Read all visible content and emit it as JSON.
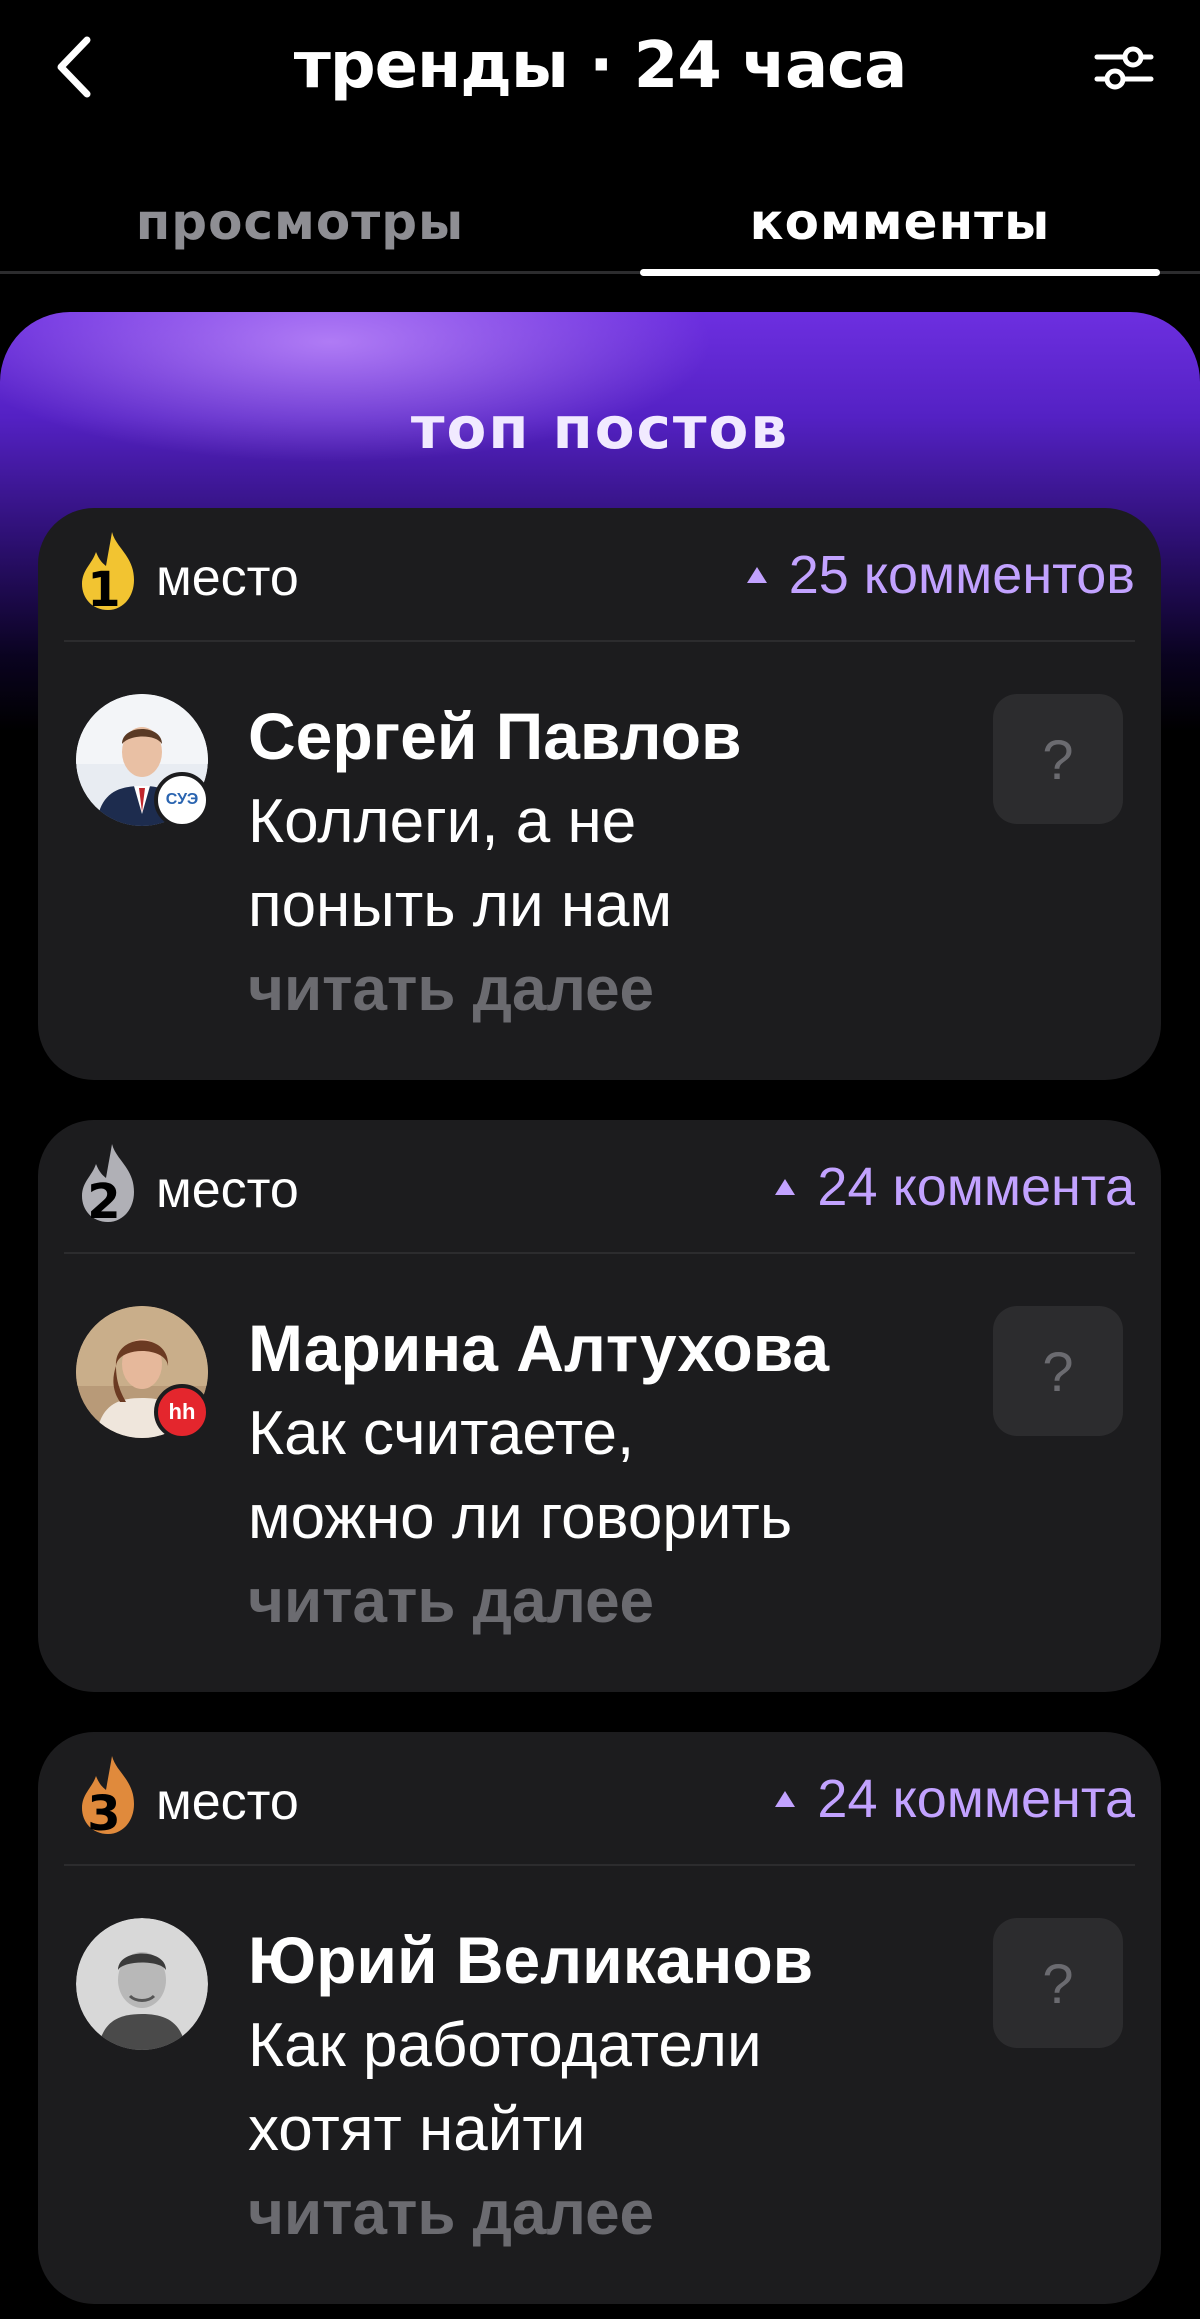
{
  "header": {
    "title": "тренды · 24 часа"
  },
  "tabs": [
    {
      "label": "просмотры",
      "active": false
    },
    {
      "label": "комменты",
      "active": true
    }
  ],
  "banner": {
    "title": "топ постов"
  },
  "posts": [
    {
      "rank": "1",
      "rank_label": "место",
      "rank_color": "#f2c431",
      "comments": "25 комментов",
      "author": "Сергей Павлов",
      "snippet_line1": "Коллеги, а не",
      "snippet_line2": "поныть ли нам",
      "read_more": "читать далее",
      "company_badge": "СУЭ",
      "help_label": "?"
    },
    {
      "rank": "2",
      "rank_label": "место",
      "rank_color": "#b0b0b6",
      "comments": "24 коммента",
      "author": "Марина Алтухова",
      "snippet_line1": "Как считаете,",
      "snippet_line2": "можно ли говорить",
      "read_more": "читать далее",
      "company_badge": "hh",
      "help_label": "?"
    },
    {
      "rank": "3",
      "rank_label": "место",
      "rank_color": "#e08a3c",
      "comments": "24 коммента",
      "author": "Юрий Великанов",
      "snippet_line1": "Как работодатели",
      "snippet_line2": "хотят найти",
      "read_more": "читать далее",
      "help_label": "?"
    }
  ],
  "colors": {
    "accent": "#c2a2ff",
    "card_bg": "#1c1c1e",
    "muted": "#6b6b70"
  }
}
